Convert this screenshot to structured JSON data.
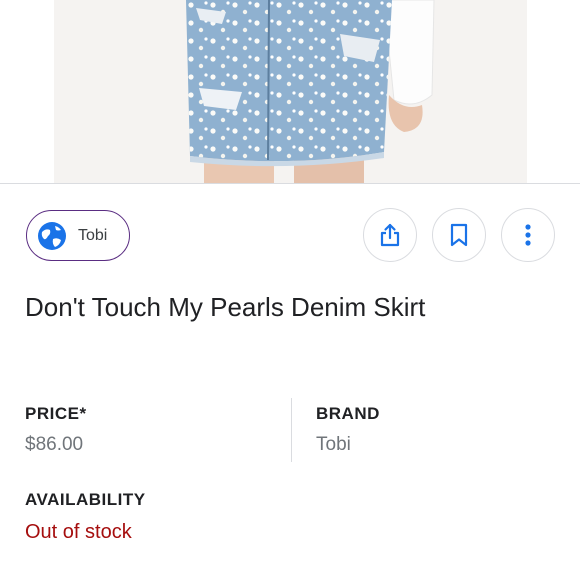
{
  "product_image": {
    "alt": ""
  },
  "source": {
    "name": "Tobi",
    "icon": "globe-icon"
  },
  "actions": [
    {
      "name": "share",
      "icon": "share-icon"
    },
    {
      "name": "save",
      "icon": "bookmark-icon"
    },
    {
      "name": "more",
      "icon": "more-vert-icon"
    }
  ],
  "product": {
    "title": "Don't Touch My Pearls Denim Skirt"
  },
  "details": {
    "price_label": "PRICE*",
    "price_value": "$86.00",
    "brand_label": "BRAND",
    "brand_value": "Tobi",
    "availability_label": "AVAILABILITY",
    "availability_value": "Out of stock"
  },
  "colors": {
    "accent": "#1a73e8",
    "chip_border": "#5a2d82",
    "out_of_stock": "#a50e0e",
    "value_gray": "#70757a"
  }
}
